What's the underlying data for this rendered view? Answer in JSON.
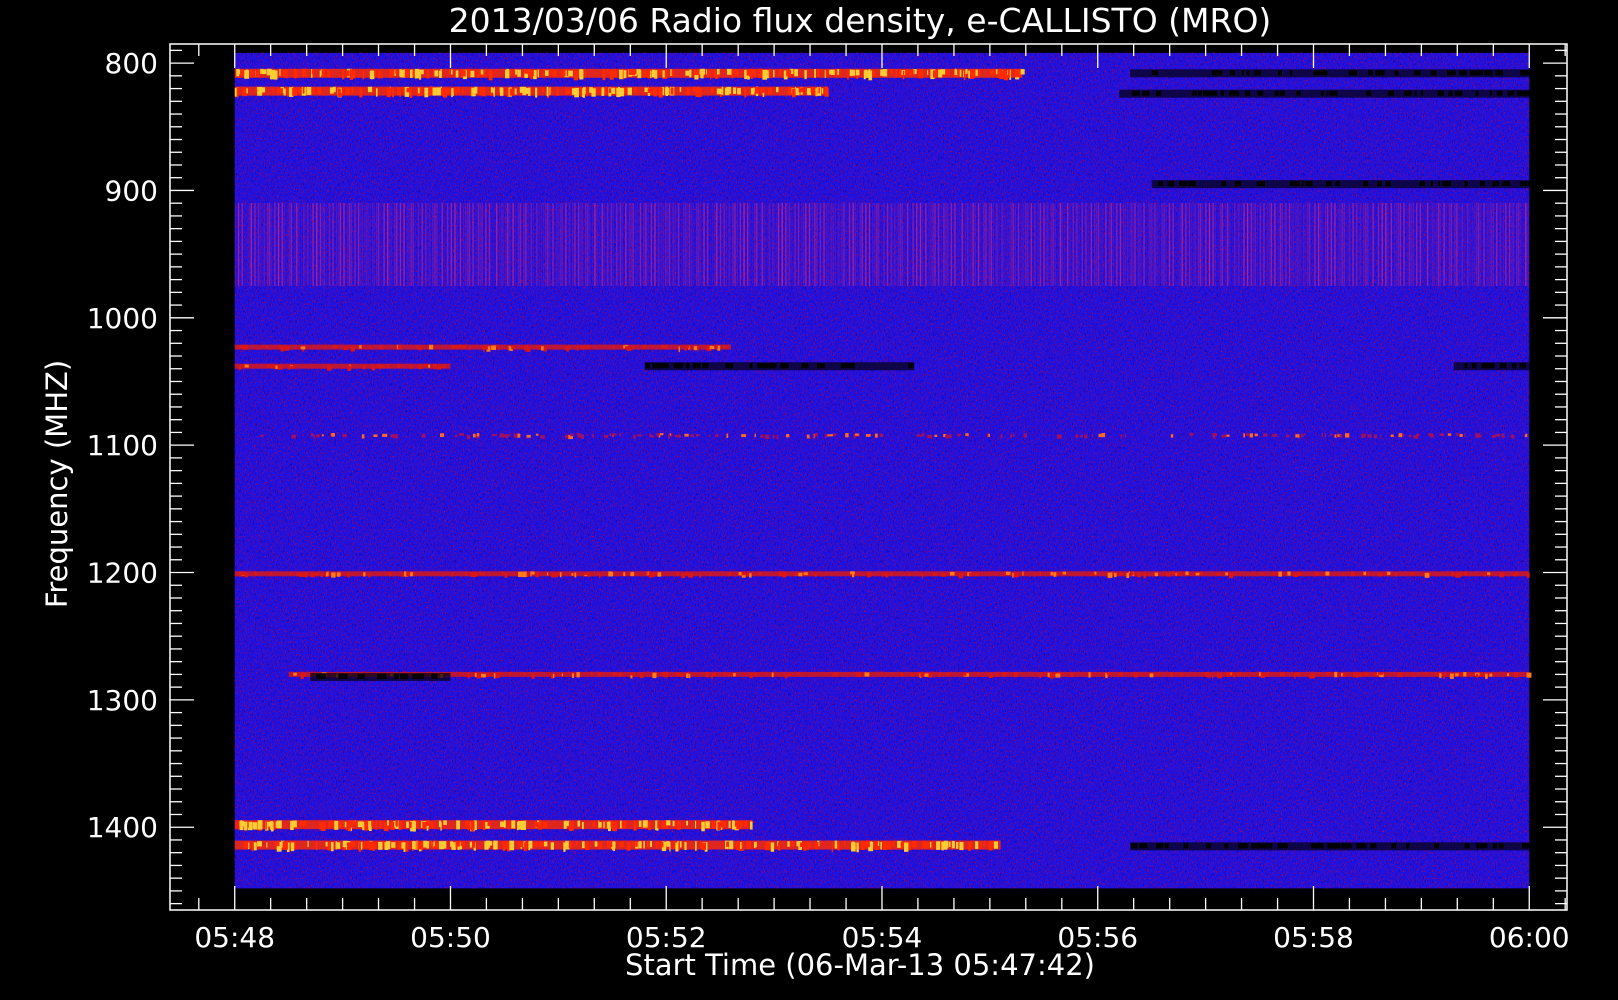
{
  "chart_data": {
    "type": "heatmap",
    "title": "2013/03/06  Radio flux density, e-CALLISTO (MRO)",
    "xlabel": "Start Time (06-Mar-13 05:47:42)",
    "ylabel": "Frequency (MHZ)",
    "x_ticks": [
      "05:48",
      "05:50",
      "05:52",
      "05:54",
      "05:56",
      "05:58",
      "06:00"
    ],
    "y_ticks": [
      800,
      900,
      1000,
      1100,
      1200,
      1300,
      1400
    ],
    "xlim_minutes_after_0548": [
      -0.6,
      12.35
    ],
    "ylim": [
      1465,
      785
    ],
    "data_extent": {
      "time": [
        "05:48",
        "06:00"
      ],
      "frequency_mhz": [
        792,
        1448
      ]
    },
    "background_color": "#1a12e6",
    "emission_bands": [
      {
        "freq": 808,
        "start_min": 0.0,
        "end_min": 7.3,
        "intensity": "high"
      },
      {
        "freq": 822,
        "start_min": 0.0,
        "end_min": 5.5,
        "intensity": "high"
      },
      {
        "freq": 1023,
        "start_min": 0.0,
        "end_min": 4.6,
        "intensity": "medium"
      },
      {
        "freq": 1038,
        "start_min": 0.0,
        "end_min": 2.0,
        "intensity": "medium"
      },
      {
        "freq": 1092,
        "start_min": 0.2,
        "end_min": 12.0,
        "intensity": "low"
      },
      {
        "freq": 1201,
        "start_min": 0.0,
        "end_min": 12.0,
        "intensity": "medium"
      },
      {
        "freq": 1280,
        "start_min": 0.5,
        "end_min": 12.0,
        "intensity": "medium"
      },
      {
        "freq": 1398,
        "start_min": 0.0,
        "end_min": 4.8,
        "intensity": "high"
      },
      {
        "freq": 1414,
        "start_min": 0.0,
        "end_min": 7.1,
        "intensity": "high"
      }
    ],
    "absorption_bands": [
      {
        "freq": 808,
        "start_min": 8.3,
        "end_min": 12.0
      },
      {
        "freq": 824,
        "start_min": 8.2,
        "end_min": 12.0
      },
      {
        "freq": 895,
        "start_min": 8.5,
        "end_min": 12.0
      },
      {
        "freq": 1038,
        "start_min": 3.8,
        "end_min": 6.3
      },
      {
        "freq": 1038,
        "start_min": 11.3,
        "end_min": 12.0
      },
      {
        "freq": 1282,
        "start_min": 0.7,
        "end_min": 2.0
      },
      {
        "freq": 1415,
        "start_min": 8.3,
        "end_min": 12.0
      }
    ],
    "rfi_region": {
      "freq_from": 910,
      "freq_to": 975
    }
  }
}
